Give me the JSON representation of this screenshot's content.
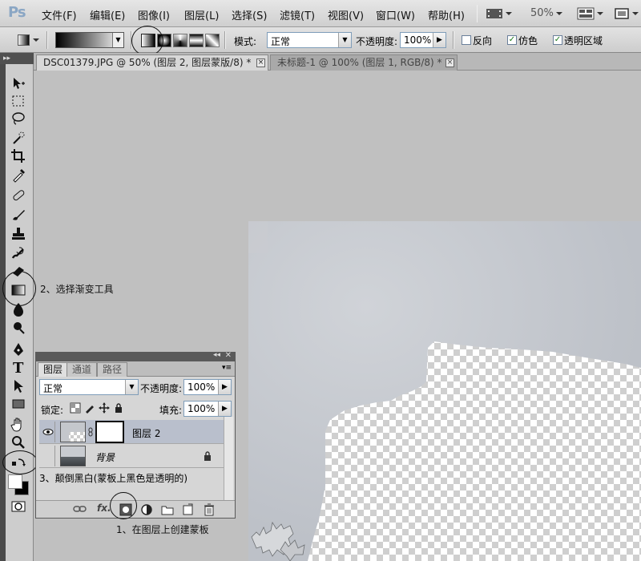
{
  "app": {
    "logo": "Ps"
  },
  "menubar": {
    "items": [
      "文件(F)",
      "编辑(E)",
      "图像(I)",
      "图层(L)",
      "选择(S)",
      "滤镜(T)",
      "视图(V)",
      "窗口(W)",
      "帮助(H)"
    ],
    "zoom": "50%"
  },
  "options": {
    "mode_label": "模式:",
    "mode_value": "正常",
    "opacity_label": "不透明度:",
    "opacity_value": "100%",
    "reverse_label": "反向",
    "dither_label": "仿色",
    "transparency_label": "透明区域",
    "check_mark": "✓"
  },
  "tabs": [
    {
      "label": "DSC01379.JPG @ 50% (图层 2, 图层蒙版/8) *",
      "close": "×"
    },
    {
      "label": "未标题-1 @ 100% (图层 1, RGB/8) *",
      "close": "×"
    }
  ],
  "annotations": {
    "step2": "2、选择渐变工具",
    "step3": "3、颠倒黑白(蒙板上黑色是透明的)",
    "step1": "1、在图层上创建蒙板"
  },
  "layers_panel": {
    "tabs": [
      "图层",
      "通道",
      "路径"
    ],
    "blend_mode": "正常",
    "opacity_label": "不透明度:",
    "opacity_value": "100%",
    "lock_label": "锁定:",
    "fill_label": "填充:",
    "fill_value": "100%",
    "layers": [
      {
        "name": "图层 2",
        "selected": true
      },
      {
        "name": "背景",
        "selected": false
      }
    ],
    "footer_fx": "fx."
  },
  "colors": {
    "menubar": "#d8d8d8",
    "workarea": "#c0c0c0",
    "selected_layer": "#b9bfcc"
  }
}
